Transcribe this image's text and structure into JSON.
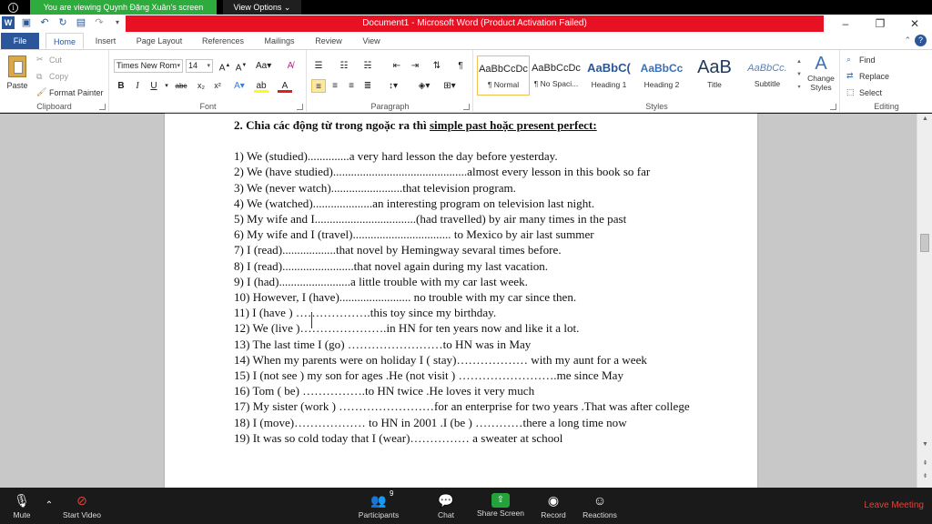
{
  "zoom_top": {
    "viewing": "You are viewing Quynh Đặng Xuân's screen",
    "view_options": "View Options"
  },
  "window": {
    "title": "Document1 - Microsoft Word (Product Activation Failed)"
  },
  "tabs": [
    "File",
    "Home",
    "Insert",
    "Page Layout",
    "References",
    "Mailings",
    "Review",
    "View"
  ],
  "ribbon": {
    "clipboard": {
      "paste": "Paste",
      "cut": "Cut",
      "copy": "Copy",
      "format_painter": "Format Painter",
      "label": "Clipboard"
    },
    "font": {
      "family": "Times New Rom",
      "size": "14",
      "label": "Font"
    },
    "paragraph": {
      "label": "Paragraph"
    },
    "styles": {
      "label": "Styles",
      "items": [
        {
          "preview": "AaBbCcDc",
          "name": "¶ Normal"
        },
        {
          "preview": "AaBbCcDc",
          "name": "¶ No Spaci..."
        },
        {
          "preview": "AaBbC(",
          "name": "Heading 1"
        },
        {
          "preview": "AaBbCc",
          "name": "Heading 2"
        },
        {
          "preview": "AaB",
          "name": "Title"
        },
        {
          "preview": "AaBbCc.",
          "name": "Subtitle"
        }
      ],
      "change_styles": "Change Styles"
    },
    "editing": {
      "find": "Find",
      "replace": "Replace",
      "select": "Select",
      "label": "Editing"
    }
  },
  "document": {
    "heading_prefix": "2. Chia các động từ trong ngoặc ra thì ",
    "heading_underlined": "simple past hoặc present perfect:",
    "lines": [
      "1) We (studied)..............a very hard lesson the day before yesterday.",
      "2) We (have studied).............................................almost every lesson in this book so far",
      "3) We (never watch)........................that television program.",
      "4) We (watched)....................an interesting program on television last night.",
      "5) My wife and I..................................(had travelled) by air many times in the past",
      "6) My wife and I (travel)................................. to Mexico by air last summer",
      "7) I (read)..................that novel by Hemingway sevaral times before.",
      "8) I (read)........................that novel again during my last vacation.",
      "9) I (had)........................a little trouble with my car last week.",
      "10) However, I (have)........................ no trouble with my car since then.",
      "11) I (have ) ……………….this toy since my birthday.",
      "12) We (live )………………….in HN for ten years now and like it a lot.",
      "13) The last time I (go) ……………………to HN was in May",
      "14) When my parents were on holiday I ( stay)……………… with my aunt for a week",
      "15) I (not see ) my son for ages .He (not visit ) …………………….me since May",
      "16) Tom ( be) …………….to HN twice .He loves it very much",
      "17) My sister (work ) ……………………for an enterprise for two years .That was after college",
      "18) I (move)……………… to HN in 2001 .I (be ) …………there a long time now",
      "19) It was so cold today that I (wear)…………… a sweater at school"
    ]
  },
  "zoom_bar": {
    "mute": "Mute",
    "start_video": "Start Video",
    "participants": "Participants",
    "participants_count": "9",
    "chat": "Chat",
    "share_screen": "Share Screen",
    "record": "Record",
    "reactions": "Reactions",
    "leave": "Leave Meeting"
  }
}
